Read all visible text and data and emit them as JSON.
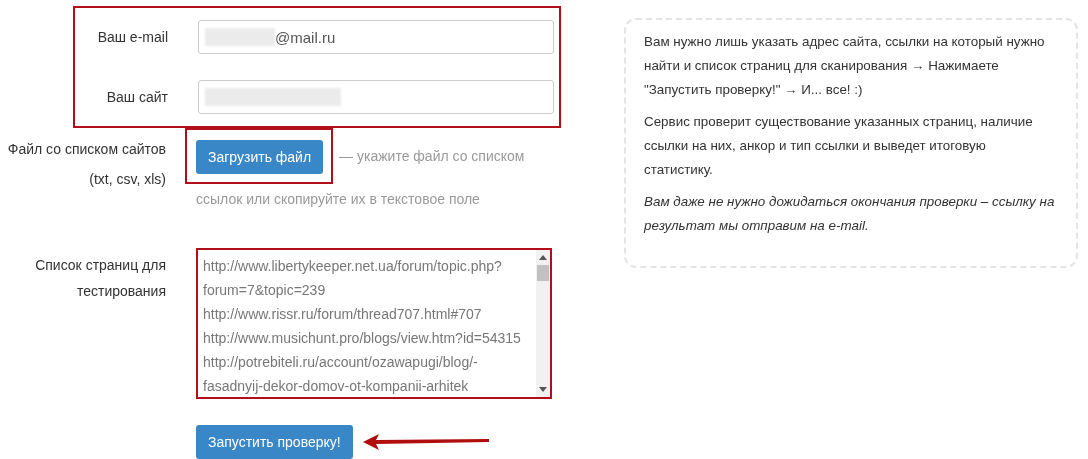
{
  "form": {
    "email": {
      "label": "Ваш e-mail",
      "value": "@mail.ru",
      "redacted": true
    },
    "site": {
      "label": "Ваш сайт",
      "redacted": true
    },
    "file": {
      "label": "Файл со списком сайтов",
      "formats": "(txt, csv, xls)",
      "button": "Загрузить файл",
      "hint_lines": [
        "— укажите файл со списком",
        "ссылок или скопируйте их в текстовое поле"
      ]
    },
    "pages": {
      "label": "Список страниц для тестирования",
      "urls": [
        "http://www.libertykeeper.net.ua/forum/topic.php?forum=7&topic=239",
        "http://www.rissr.ru/forum/thread707.html#707",
        "http://www.musichunt.pro/blogs/view.htm?id=54315",
        "http://potrebiteli.ru/account/ozawapugi/blog/-fasadnyij-dekor-domov-ot-kompanii-arhitek"
      ]
    },
    "submit": "Запустить проверку!"
  },
  "info": {
    "paragraphs": [
      {
        "text": "Вам нужно лишь указать адрес сайта, ссылки на который нужно найти и список страниц для сканирования → Нажимаете \"Запустить проверку!\" → И... все! :)",
        "italic": false
      },
      {
        "text": "Сервис проверит существование указанных страниц, наличие ссылки на них, анкор и тип ссылки и выведет итоговую статистику.",
        "italic": false
      },
      {
        "text": "Вам даже не нужно дожидаться окончания проверки – ссылку на результат мы отправим на e-mail.",
        "italic": true
      }
    ]
  }
}
